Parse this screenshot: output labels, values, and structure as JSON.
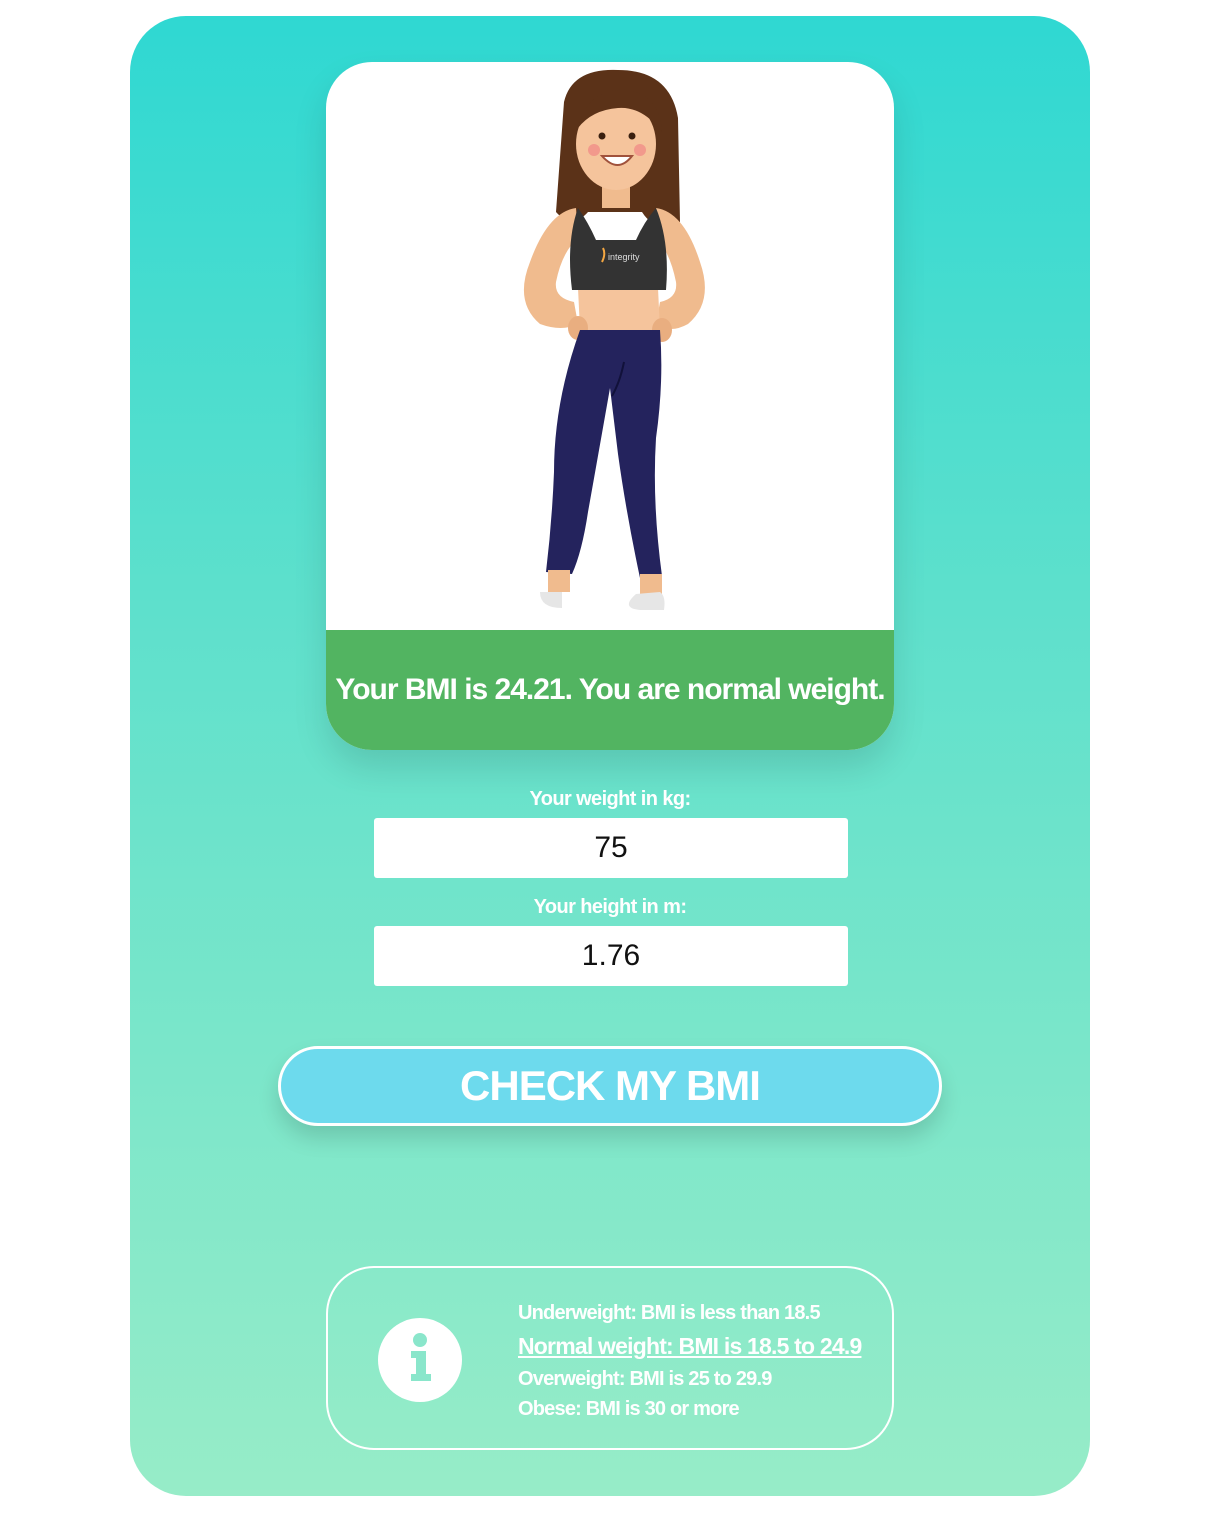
{
  "result": {
    "message": "Your BMI is 24.21. You are normal weight.",
    "status_color": "#52b461"
  },
  "figure": {
    "icon": "woman-normal-weight-illustration",
    "shirt_logo": "integrity"
  },
  "form": {
    "weight_label": "Your weight in kg:",
    "weight_value": "75",
    "height_label": "Your height in m:",
    "height_value": "1.76"
  },
  "button": {
    "label": "CHECK MY BMI"
  },
  "info": {
    "icon": "info-icon",
    "lines": [
      "Underweight: BMI is less than 18.5",
      "Normal weight: BMI is 18.5 to 24.9",
      "Overweight: BMI is 25 to 29.9",
      "Obese: BMI is 30 or more"
    ],
    "active_index": 1
  },
  "colors": {
    "gradient_top": "#2fd8d2",
    "gradient_bottom": "#97ecc8",
    "button": "#6ddaed"
  }
}
